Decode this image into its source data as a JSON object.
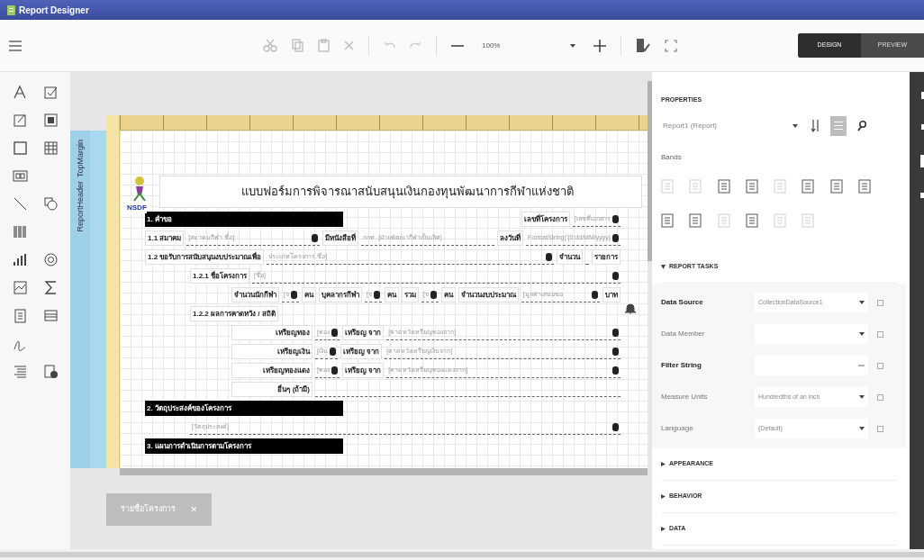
{
  "window": {
    "title": "Report Designer"
  },
  "toolbar": {
    "zoom": "100%",
    "modes": [
      {
        "label": "DESIGN",
        "selected": true
      },
      {
        "label": "PREVIEW",
        "selected": false
      }
    ]
  },
  "band_labels": [
    "TopMargin",
    "ReportHeader"
  ],
  "report": {
    "title": "แบบฟอร์มการพิจารณาสนับสนุนเงินกองทุนพัฒนาการกีฬาแห่งชาติ",
    "logo_caption": "NSDF",
    "lines": [
      {
        "kind": "section",
        "parts": [
          {
            "kind": "heading",
            "text": "1. คำขอ"
          },
          {
            "kind": "label",
            "text": "เลขที่โครงการ"
          },
          {
            "kind": "value",
            "text": "[เลขที่เอกสาร",
            "bound": true
          }
        ]
      },
      {
        "kind": "line",
        "parts": [
          {
            "kind": "label",
            "text": "1.1 สมาคม"
          },
          {
            "kind": "fill",
            "text": "[สมาคมกีฬา ชื่อ]",
            "bound": true
          },
          {
            "kind": "label",
            "text": "มีหนังสือที่"
          },
          {
            "kind": "fill",
            "text": "กกท. (ฝ่ายพัฒนากีฬาเป็นเลิศ)",
            "bound": false
          },
          {
            "kind": "label",
            "text": "ลงวันที่"
          },
          {
            "kind": "value",
            "text": "FormatString('{0:dd/MM/yyyy}",
            "bound": true
          }
        ]
      },
      {
        "kind": "line",
        "parts": [
          {
            "kind": "label",
            "text": "1.2 ขอรับการสนับสนุนงบประมาณเพื่อ"
          },
          {
            "kind": "fill",
            "text": "ประเภทโครงการ.ชื่อ]",
            "bound": true
          },
          {
            "kind": "label",
            "text": "จำนวน"
          },
          {
            "kind": "value",
            "bound": false
          },
          {
            "kind": "label",
            "text": "รายการ"
          }
        ]
      },
      {
        "kind": "sub",
        "parts": [
          {
            "kind": "label",
            "text": "1.2.1 ชื่อโครงการ"
          },
          {
            "kind": "fill",
            "text": "[ชื่อ]",
            "bound": true
          }
        ]
      },
      {
        "kind": "subsub",
        "parts": [
          {
            "kind": "label",
            "text": "จำนวนนักกีฬา"
          },
          {
            "kind": "value",
            "text": "[จ",
            "bound": true
          },
          {
            "kind": "label",
            "text": "คน"
          },
          {
            "kind": "label",
            "text": "บุคลากรกีฬา"
          },
          {
            "kind": "value",
            "text": "[จ",
            "bound": true
          },
          {
            "kind": "label",
            "text": "คน"
          },
          {
            "kind": "label",
            "text": "รวม"
          },
          {
            "kind": "value",
            "text": "[จ",
            "bound": true
          },
          {
            "kind": "label",
            "text": "คน"
          },
          {
            "kind": "label",
            "text": "จำนวนงบประมาณ"
          },
          {
            "kind": "fill",
            "text": "[มูลค่าเสนอขอ",
            "bound": true
          },
          {
            "kind": "label",
            "text": "บาท"
          }
        ]
      },
      {
        "kind": "sub",
        "parts": [
          {
            "kind": "label",
            "text": "1.2.2 ผลการคาดหวัง / สถิติ"
          }
        ]
      },
      {
        "kind": "medal",
        "parts": [
          {
            "kind": "label",
            "text": "เหรียญทอง"
          },
          {
            "kind": "value",
            "text": "[ทอง",
            "bound": true
          },
          {
            "kind": "label",
            "text": "เหรียญ จาก"
          },
          {
            "kind": "fill",
            "text": "[คาดหวังเหรียญทองจาก]",
            "bound": true
          }
        ]
      },
      {
        "kind": "medal",
        "parts": [
          {
            "kind": "label",
            "text": "เหรียญเงิน"
          },
          {
            "kind": "value",
            "text": "[เงิน",
            "bound": true
          },
          {
            "kind": "label",
            "text": "เหรียญ จาก"
          },
          {
            "kind": "fill",
            "text": "[คาดหวังเหรียญเงินจาก]",
            "bound": true
          }
        ]
      },
      {
        "kind": "medal",
        "parts": [
          {
            "kind": "label",
            "text": "เหรียญทองแดง"
          },
          {
            "kind": "value",
            "text": "[ทอง",
            "bound": true
          },
          {
            "kind": "label",
            "text": "เหรียญ จาก"
          },
          {
            "kind": "fill",
            "text": "[คาดหวังเหรียญทองแดงจาก]",
            "bound": true
          }
        ]
      },
      {
        "kind": "medal",
        "parts": [
          {
            "kind": "label",
            "text": "อื่นๆ (ถ้ามี)"
          },
          {
            "kind": "fill",
            "bound": false
          }
        ]
      },
      {
        "kind": "section",
        "parts": [
          {
            "kind": "heading",
            "text": "2. วัตถุประสงค์ของโครงการ"
          }
        ]
      },
      {
        "kind": "sub",
        "parts": [
          {
            "kind": "fill",
            "text": "[วัตถุประสงค์]",
            "bound": true
          }
        ]
      },
      {
        "kind": "section",
        "parts": [
          {
            "kind": "heading",
            "text": "3. แผนการดำเนินการตามโครงการ"
          }
        ]
      }
    ]
  },
  "toast": {
    "text": "รายชื่อโครงการ",
    "close": "×"
  },
  "properties": {
    "title": "PROPERTIES",
    "selector": "Report1 (Report)",
    "bands_title": "Bands",
    "bands": [
      {
        "disabled": true
      },
      {
        "disabled": true
      },
      {
        "disabled": false
      },
      {
        "disabled": false
      },
      {
        "disabled": true
      },
      {
        "disabled": false
      },
      {
        "disabled": false
      },
      {
        "disabled": false
      },
      {
        "disabled": false
      },
      {
        "disabled": false
      },
      {
        "disabled": true
      },
      {
        "disabled": false
      },
      {
        "disabled": true
      },
      {
        "disabled": true
      }
    ],
    "sections": [
      {
        "title": "REPORT TASKS",
        "expanded": true,
        "rows": [
          {
            "label": "Data Source",
            "value": "CollectionDataSource1",
            "modified": true,
            "kind": "dropdown"
          },
          {
            "label": "Data Member",
            "value": "",
            "modified": false,
            "kind": "dropdown"
          },
          {
            "label": "Filter String",
            "value": "",
            "modified": true,
            "kind": "text"
          },
          {
            "label": "Measure Units",
            "value": "Hundredths of an inch",
            "modified": false,
            "kind": "dropdown"
          },
          {
            "label": "Language",
            "value": "(Default)",
            "modified": false,
            "kind": "dropdown"
          }
        ]
      },
      {
        "title": "APPEARANCE",
        "expanded": false
      },
      {
        "title": "BEHAVIOR",
        "expanded": false
      },
      {
        "title": "DATA",
        "expanded": false
      }
    ]
  }
}
